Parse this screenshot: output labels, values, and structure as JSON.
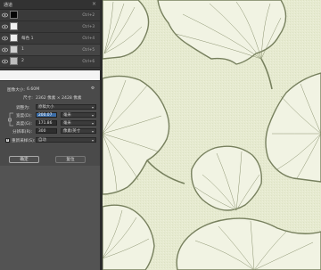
{
  "layers_panel": {
    "title": "通道",
    "close_glyph": "×",
    "items": [
      {
        "name": "",
        "shortcut": "Ctrl+2"
      },
      {
        "name": "",
        "shortcut": "Ctrl+3"
      },
      {
        "name": "每色 1",
        "shortcut": "Ctrl+4"
      },
      {
        "name": "1",
        "shortcut": "Ctrl+5"
      },
      {
        "name": "2",
        "shortcut": "Ctrl+6"
      },
      {
        "name": "3",
        "shortcut": "Ctrl+7"
      }
    ]
  },
  "image_size_dialog": {
    "size_label": "图像大小:",
    "size_value": "6.60M",
    "gear_glyph": "⚙",
    "dimensions_label": "尺寸:",
    "dimensions_value": "2362 像素  ×  2428 像素",
    "fit_label": "调整为:",
    "fit_value": "原稿大小",
    "width_label": "宽度(D):",
    "width_value": "200.07",
    "width_unit": "毫米",
    "height_label": "高度(G):",
    "height_value": "171.86",
    "height_unit": "毫米",
    "resolution_label": "分辨率(R):",
    "resolution_value": "300",
    "resolution_unit": "像素/英寸",
    "resample_label": "重新采样(S):",
    "resample_value": "自动",
    "ok_label": "确定",
    "reset_label": "复位"
  },
  "colors": {
    "canvas_bg": "#e8ecd3",
    "leaf_fill": "#f2f4e6",
    "leaf_stroke": "#77805e"
  }
}
